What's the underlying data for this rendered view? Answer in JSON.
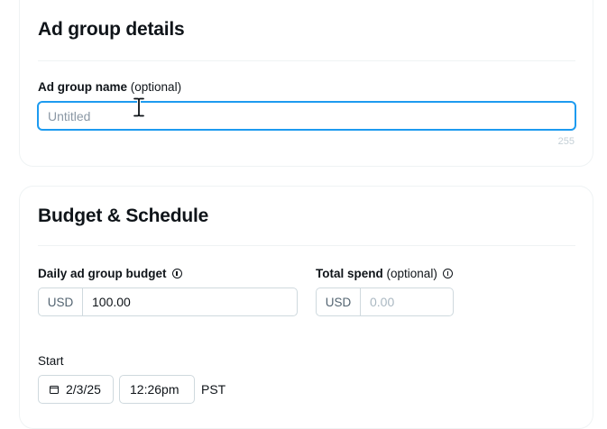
{
  "ad_group_details": {
    "title": "Ad group details",
    "name_label": "Ad group name",
    "name_optional": "(optional)",
    "name_value": "",
    "name_placeholder": "Untitled",
    "char_limit": "255"
  },
  "budget_schedule": {
    "title": "Budget & Schedule",
    "daily_budget": {
      "label": "Daily ad group budget",
      "currency": "USD",
      "value": "100.00",
      "placeholder": ""
    },
    "total_spend": {
      "label": "Total spend",
      "optional": "(optional)",
      "currency": "USD",
      "value": "",
      "placeholder": "0.00"
    },
    "start": {
      "label": "Start",
      "date": "2/3/25",
      "time": "12:26pm",
      "timezone": "PST"
    }
  },
  "icons": {
    "info": "info-circle-icon",
    "calendar": "calendar-icon",
    "cursor": "text-cursor-icon"
  },
  "colors": {
    "focus_border": "#1d9bf0",
    "field_border": "#cfd9de",
    "text": "#0f1419",
    "muted": "#536471"
  }
}
